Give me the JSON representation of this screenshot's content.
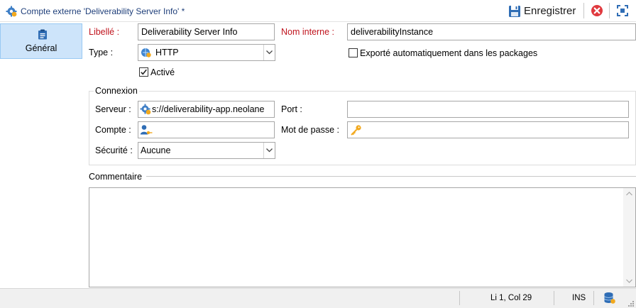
{
  "window": {
    "title": "Compte externe 'Deliverability Server Info' *",
    "save_label": "Enregistrer"
  },
  "nav": {
    "items": [
      {
        "label": "Général",
        "icon": "clipboard-icon",
        "selected": true
      }
    ]
  },
  "form": {
    "libelle_label": "Libellé :",
    "libelle_value": "Deliverability Server Info",
    "nom_interne_label": "Nom interne :",
    "nom_interne_value": "deliverabilityInstance",
    "type_label": "Type :",
    "type_value": "HTTP",
    "exporte_label": "Exporté automatiquement dans les packages",
    "exporte_checked": false,
    "active_label": "Activé",
    "active_checked": true
  },
  "connexion": {
    "title": "Connexion",
    "serveur_label": "Serveur :",
    "serveur_value": "s://deliverability-app.neolane",
    "port_label": "Port :",
    "port_value": "",
    "compte_label": "Compte :",
    "compte_value": "",
    "mot_de_passe_label": "Mot de passe :",
    "mot_de_passe_value": "",
    "securite_label": "Sécurité :",
    "securite_value": "Aucune"
  },
  "commentaire": {
    "title": "Commentaire",
    "value": ""
  },
  "status": {
    "position": "Li 1, Col 29",
    "mode": "INS"
  },
  "colors": {
    "required_label": "#c0141e",
    "nav_selected_bg": "#cde4fa",
    "title_text": "#1f3f7a"
  }
}
